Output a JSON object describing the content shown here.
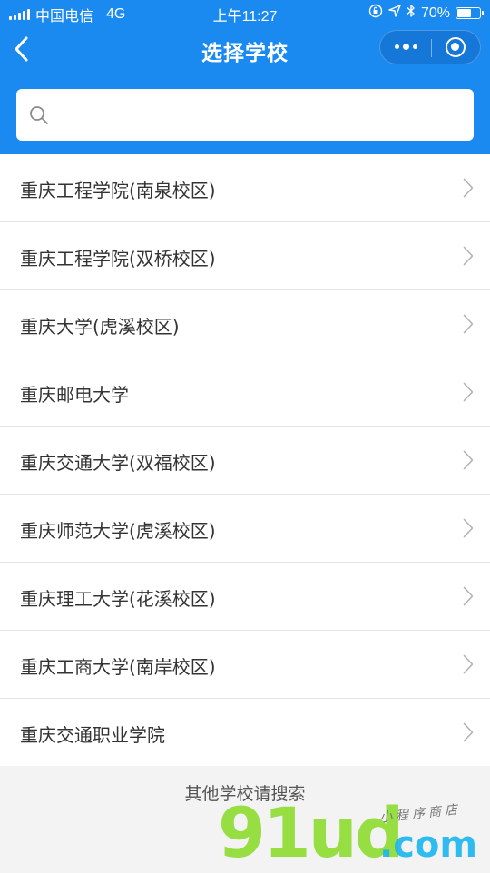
{
  "status_bar": {
    "carrier": "中国电信",
    "network": "4G",
    "time": "上午11:27",
    "battery_text": "70%",
    "battery_level": 0.7
  },
  "nav": {
    "title": "选择学校"
  },
  "search": {
    "placeholder": "",
    "value": ""
  },
  "schools": [
    {
      "name": "重庆工程学院(南泉校区)"
    },
    {
      "name": "重庆工程学院(双桥校区)"
    },
    {
      "name": "重庆大学(虎溪校区)"
    },
    {
      "name": "重庆邮电大学"
    },
    {
      "name": "重庆交通大学(双福校区)"
    },
    {
      "name": "重庆师范大学(虎溪校区)"
    },
    {
      "name": "重庆理工大学(花溪校区)"
    },
    {
      "name": "重庆工商大学(南岸校区)"
    },
    {
      "name": "重庆交通职业学院"
    }
  ],
  "footer": {
    "hint": "其他学校请搜索"
  },
  "watermark": {
    "brand": "91ud",
    "domain": ".com",
    "tagline": "小程序商店"
  },
  "colors": {
    "header_bg": "#1a89f0",
    "page_bg": "#f3f3f3",
    "watermark_green": "#8ddc2f",
    "watermark_blue": "#19b5f0"
  }
}
